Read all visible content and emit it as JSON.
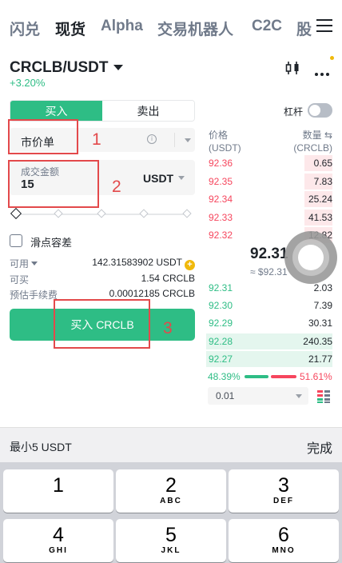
{
  "top_tabs": [
    "闪兑",
    "现货",
    "Alpha",
    "交易机器人",
    "C2C",
    "股"
  ],
  "active_tab_index": 1,
  "pair": {
    "symbol": "CRCLB/USDT",
    "change": "+3.20%"
  },
  "buy_sell": {
    "buy": "买入",
    "sell": "卖出"
  },
  "leverage": {
    "label": "杠杆",
    "enabled": false
  },
  "order_type": {
    "value": "市价单"
  },
  "amount": {
    "label": "成交金额",
    "value": "15",
    "unit": "USDT"
  },
  "slider": {
    "percent": 0
  },
  "slippage_label": "滑点容差",
  "info": {
    "available_label": "可用",
    "available_value": "142.31583902 USDT",
    "can_buy_label": "可买",
    "can_buy_value": "1.54 CRCLB",
    "fee_label": "预估手续费",
    "fee_value": "0.00012185 CRCLB"
  },
  "buy_button": "买入 CRCLB",
  "annotations": [
    "1",
    "2",
    "3"
  ],
  "orderbook": {
    "price_header": "价格",
    "price_unit": "(USDT)",
    "qty_header": "数量 ⇆",
    "qty_unit": "(CRCLB)",
    "asks": [
      {
        "price": "92.36",
        "qty": "0.65",
        "depth": 0.22
      },
      {
        "price": "92.35",
        "qty": "7.83",
        "depth": 0.22
      },
      {
        "price": "92.34",
        "qty": "25.24",
        "depth": 0.22
      },
      {
        "price": "92.33",
        "qty": "41.53",
        "depth": 0.22
      },
      {
        "price": "92.32",
        "qty": "12.82",
        "depth": 0.22
      }
    ],
    "mid_price": "92.31",
    "mid_sub": "≈ $92.31",
    "bids": [
      {
        "price": "92.31",
        "qty": "2.03",
        "depth": 0
      },
      {
        "price": "92.30",
        "qty": "7.39",
        "depth": 0
      },
      {
        "price": "92.29",
        "qty": "30.31",
        "depth": 0
      },
      {
        "price": "92.28",
        "qty": "240.35",
        "depth": 1
      },
      {
        "price": "92.27",
        "qty": "21.77",
        "depth": 1
      }
    ],
    "buy_ratio": "48.39%",
    "sell_ratio": "51.61%",
    "precision": "0.01"
  },
  "keyboard": {
    "min_label": "最小5 USDT",
    "done": "完成",
    "keys": [
      {
        "n": "1",
        "l": ""
      },
      {
        "n": "2",
        "l": "ABC"
      },
      {
        "n": "3",
        "l": "DEF"
      },
      {
        "n": "4",
        "l": "GHI"
      },
      {
        "n": "5",
        "l": "JKL"
      },
      {
        "n": "6",
        "l": "MNO"
      }
    ]
  },
  "colors": {
    "green": "#2ebd85",
    "red": "#f6465d",
    "annotation": "#e3494b",
    "accent": "#f0b90b"
  }
}
